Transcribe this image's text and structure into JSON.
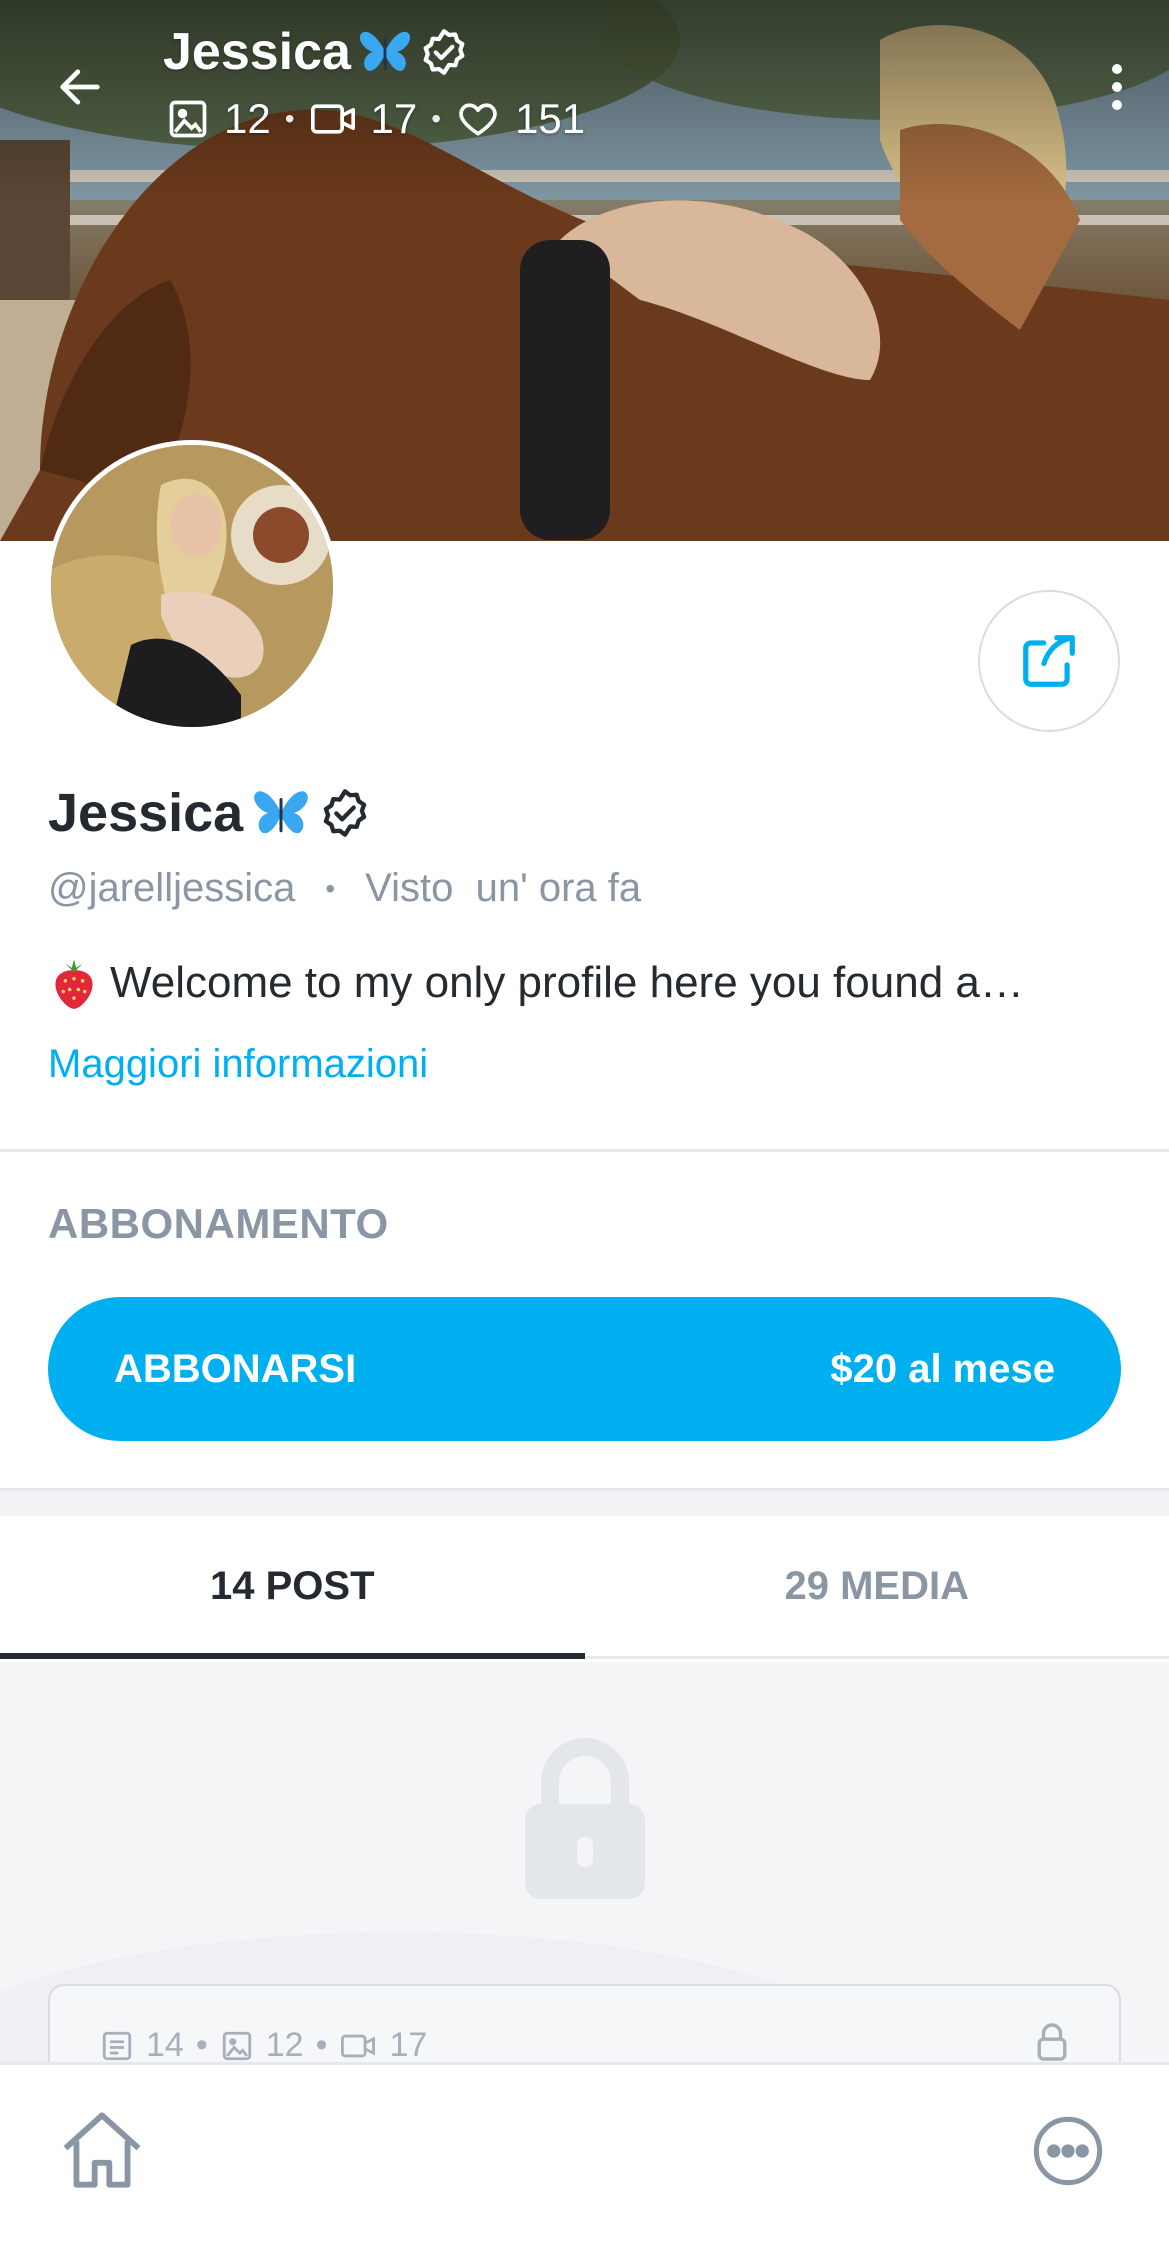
{
  "header": {
    "name": "Jessica",
    "photos_count": "12",
    "videos_count": "17",
    "likes_count": "151",
    "separator": "•"
  },
  "profile": {
    "name": "Jessica",
    "handle": "@jarelljessica",
    "separator": "•",
    "last_seen": "Visto  un' ora fa",
    "bio": "Welcome to my only profile here you found a…",
    "more_info_label": "Maggiori informazioni"
  },
  "subscription": {
    "section_title": "ABBONAMENTO",
    "button_label": "ABBONARSI",
    "price": "$20 al mese"
  },
  "tabs": [
    {
      "label": "14 POST",
      "active": true
    },
    {
      "label": "29 MEDIA",
      "active": false
    }
  ],
  "locked_card": {
    "posts_count": "14",
    "photos_count": "12",
    "videos_count": "17",
    "separator": "•"
  },
  "icons": {
    "back": "arrow-left-icon",
    "more": "more-vertical-icon",
    "verified": "verified-badge-icon",
    "butterfly": "butterfly-emoji",
    "photo": "image-icon",
    "video": "video-icon",
    "heart": "heart-icon",
    "share": "share-icon",
    "strawberry": "strawberry-emoji",
    "lock": "lock-icon",
    "home": "home-icon",
    "chat": "chat-bubble-icon"
  },
  "colors": {
    "accent": "#00aff0",
    "text_primary": "#242a30",
    "text_secondary": "#8a96a3",
    "divider": "#e6e9ec"
  }
}
